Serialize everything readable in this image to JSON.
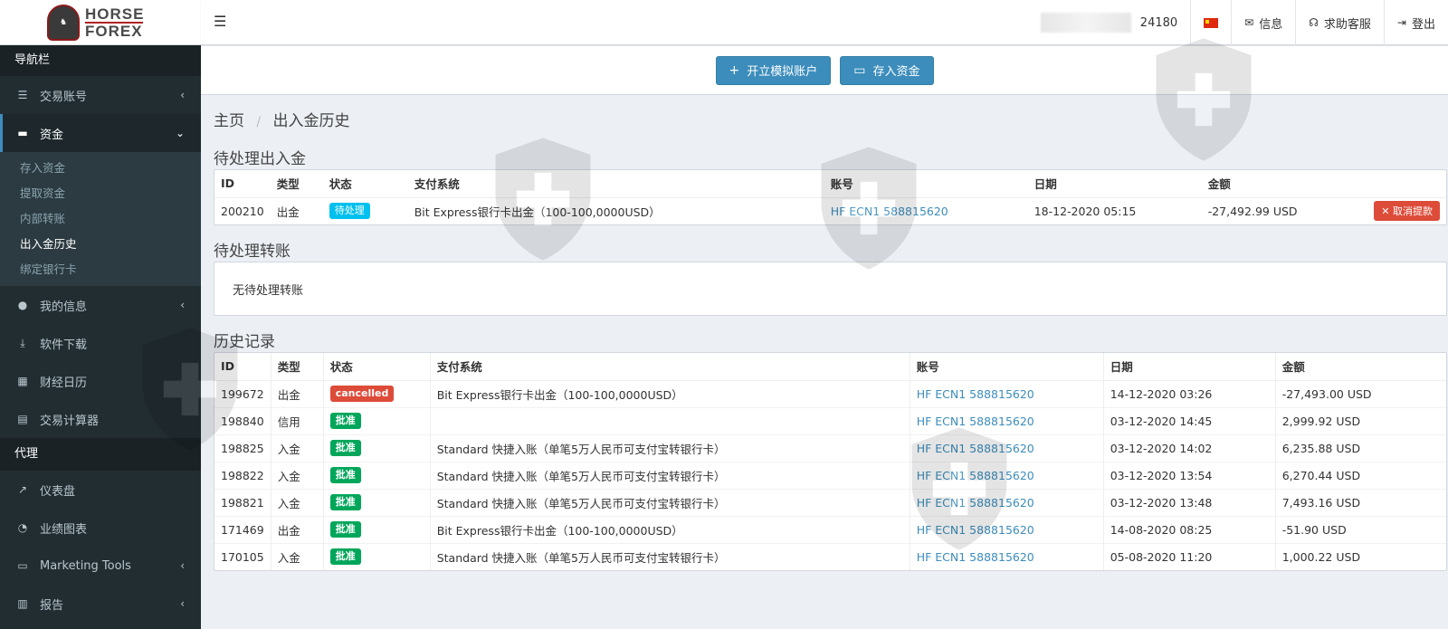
{
  "brand": {
    "line1": "HORSE",
    "line2": "FOREX"
  },
  "sidebar": {
    "header": "导航栏",
    "items": [
      {
        "label": "交易账号",
        "icon": "list-icon",
        "chevron": "‹"
      },
      {
        "label": "资金",
        "icon": "wallet-icon",
        "chevron": "⌄"
      }
    ],
    "sub_items": [
      "存入资金",
      "提取资金",
      "内部转账",
      "出入金历史",
      "绑定银行卡"
    ],
    "items2": [
      {
        "label": "我的信息",
        "icon": "user-icon",
        "chevron": "‹"
      },
      {
        "label": "软件下载",
        "icon": "download-icon",
        "chevron": ""
      },
      {
        "label": "财经日历",
        "icon": "calendar-icon",
        "chevron": ""
      },
      {
        "label": "交易计算器",
        "icon": "calculator-icon",
        "chevron": ""
      }
    ],
    "section2": "代理",
    "items3": [
      {
        "label": "仪表盘",
        "icon": "line-chart-icon",
        "chevron": ""
      },
      {
        "label": "业绩图表",
        "icon": "pie-chart-icon",
        "chevron": ""
      },
      {
        "label": "Marketing Tools",
        "icon": "briefcase-icon",
        "chevron": "‹"
      },
      {
        "label": "报告",
        "icon": "bar-chart-icon",
        "chevron": "‹"
      }
    ]
  },
  "topbar": {
    "account_suffix": "24180",
    "messages": "信息",
    "support": "求助客服",
    "logout": "登出"
  },
  "actions": {
    "open_demo": "开立模拟账户",
    "deposit": "存入资金"
  },
  "breadcrumb": {
    "home": "主页",
    "current": "出入金历史"
  },
  "pending": {
    "title": "待处理出入金",
    "headers": [
      "ID",
      "类型",
      "状态",
      "支付系统",
      "账号",
      "日期",
      "金额",
      ""
    ],
    "row": {
      "id": "200210",
      "type": "出金",
      "status": "待处理",
      "system": "Bit Express银行卡出金（100-100,0000USD）",
      "account": "HF ECN1 588815620",
      "date": "18-12-2020 05:15",
      "amount": "-27,492.99 USD",
      "cancel": "取消提款"
    }
  },
  "pending_transfer": {
    "title": "待处理转账",
    "empty": "无待处理转账"
  },
  "history": {
    "title": "历史记录",
    "headers": [
      "ID",
      "类型",
      "状态",
      "支付系统",
      "账号",
      "日期",
      "金额"
    ],
    "rows": [
      {
        "id": "199672",
        "type": "出金",
        "status": "cancelled",
        "status_kind": "danger",
        "system": "Bit Express银行卡出金（100-100,0000USD）",
        "account": "HF ECN1 588815620",
        "date": "14-12-2020 03:26",
        "amount": "-27,493.00 USD"
      },
      {
        "id": "198840",
        "type": "信用",
        "status": "批准",
        "status_kind": "success",
        "system": "",
        "account": "HF ECN1 588815620",
        "date": "03-12-2020 14:45",
        "amount": "2,999.92 USD"
      },
      {
        "id": "198825",
        "type": "入金",
        "status": "批准",
        "status_kind": "success",
        "system": "Standard 快捷入账（单笔5万人民币可支付宝转银行卡）",
        "account": "HF ECN1 588815620",
        "date": "03-12-2020 14:02",
        "amount": "6,235.88 USD"
      },
      {
        "id": "198822",
        "type": "入金",
        "status": "批准",
        "status_kind": "success",
        "system": "Standard 快捷入账（单笔5万人民币可支付宝转银行卡）",
        "account": "HF ECN1 588815620",
        "date": "03-12-2020 13:54",
        "amount": "6,270.44 USD"
      },
      {
        "id": "198821",
        "type": "入金",
        "status": "批准",
        "status_kind": "success",
        "system": "Standard 快捷入账（单笔5万人民币可支付宝转银行卡）",
        "account": "HF ECN1 588815620",
        "date": "03-12-2020 13:48",
        "amount": "7,493.16 USD"
      },
      {
        "id": "171469",
        "type": "出金",
        "status": "批准",
        "status_kind": "success",
        "system": "Bit Express银行卡出金（100-100,0000USD）",
        "account": "HF ECN1 588815620",
        "date": "14-08-2020 08:25",
        "amount": "-51.90 USD"
      },
      {
        "id": "170105",
        "type": "入金",
        "status": "批准",
        "status_kind": "success",
        "system": "Standard 快捷入账（单笔5万人民币可支付宝转银行卡）",
        "account": "HF ECN1 588815620",
        "date": "05-08-2020 11:20",
        "amount": "1,000.22 USD"
      }
    ]
  }
}
